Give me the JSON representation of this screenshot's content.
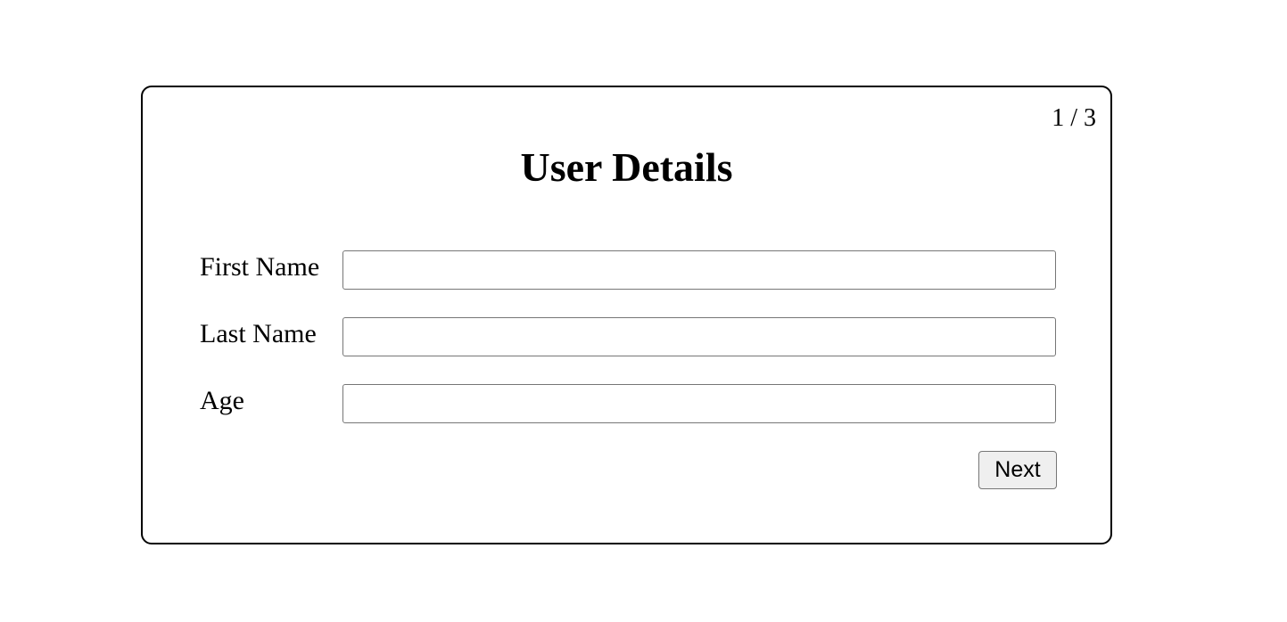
{
  "form": {
    "step_indicator": "1 / 3",
    "title": "User Details",
    "fields": [
      {
        "label": "First Name",
        "value": "",
        "placeholder": ""
      },
      {
        "label": "Last Name",
        "value": "",
        "placeholder": ""
      },
      {
        "label": "Age",
        "value": "",
        "placeholder": ""
      }
    ],
    "next_label": "Next"
  }
}
